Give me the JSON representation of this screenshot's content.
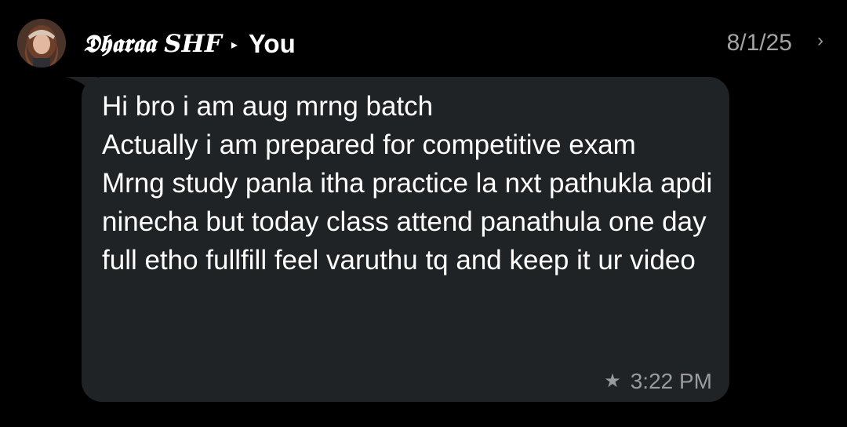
{
  "message": {
    "sender_name": "𝕯𝖍𝖆𝖗𝖆𝖆 SHF",
    "recipient": "You",
    "date": "8/1/25",
    "text": "Hi bro i am aug mrng batch\nActually i am prepared for competitive exam\nMrng study panla itha practice la nxt pathukla apdi ninecha but today class attend panathula one day full etho fullfill feel varuthu tq and keep it ur video",
    "time": "3:22 PM",
    "starred": true
  },
  "icons": {
    "arrow": "▸",
    "chevron": "›",
    "star": "★"
  },
  "colors": {
    "background": "#000000",
    "bubble": "#202326",
    "meta_text": "#9b9b9b"
  }
}
